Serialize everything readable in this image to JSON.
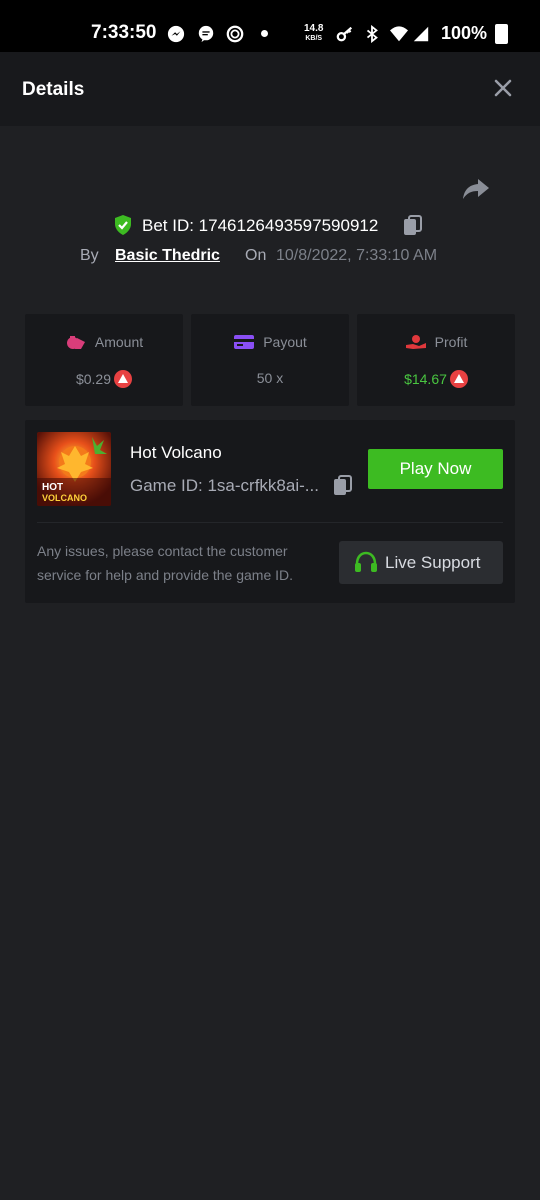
{
  "status_bar": {
    "time": "7:33:50",
    "net_speed": "14.8",
    "net_unit": "KB/S",
    "battery": "100%"
  },
  "header": {
    "title": "Details"
  },
  "bet": {
    "id_label": "Bet ID: 1746126493597590912",
    "by_label": "By",
    "user": "Basic Thedric",
    "on_label": "On",
    "date": "10/8/2022, 7:33:10 AM"
  },
  "stats": {
    "amount": {
      "label": "Amount",
      "value": "$0.29"
    },
    "payout": {
      "label": "Payout",
      "value": "50 x"
    },
    "profit": {
      "label": "Profit",
      "value": "$14.67"
    }
  },
  "game": {
    "name": "Hot Volcano",
    "id_label": "Game ID: 1sa-crfkk8ai-...",
    "play_label": "Play Now",
    "thumb_line1": "HOT",
    "thumb_line2": "VOLCANO",
    "support_text": "Any issues, please contact the customer service for help and provide the game ID.",
    "support_label": "Live Support"
  },
  "colors": {
    "accent_green": "#3dbb22",
    "profit_green": "#49c540",
    "coin_red": "#e84142"
  }
}
